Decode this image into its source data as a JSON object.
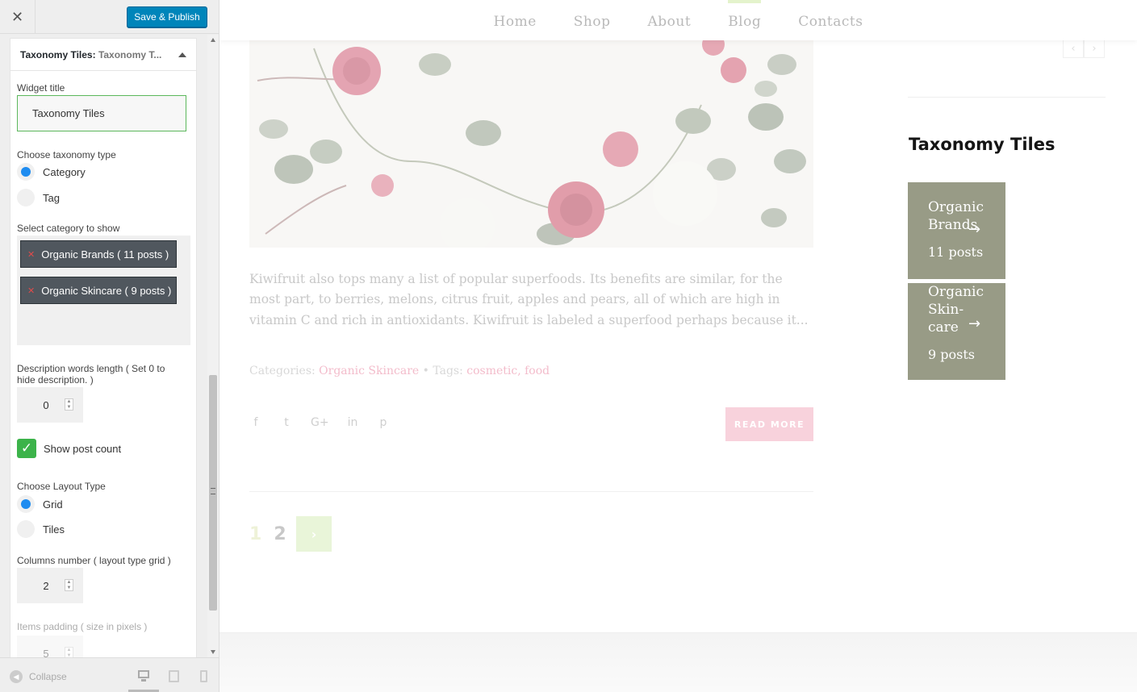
{
  "customizer": {
    "close_label": "✕",
    "publish_label": "Save & Publish",
    "widget": {
      "title": "Taxonomy Tiles:",
      "instance": "Taxonomy T...",
      "title_field_label": "Widget title",
      "title_field_value": "Taxonomy Tiles",
      "taxonomy_label": "Choose taxonomy type",
      "taxonomy_options": [
        "Category",
        "Tag"
      ],
      "taxonomy_selected": "Category",
      "category_label": "Select category to show",
      "selected_categories": [
        "Organic Brands ( 11 posts )",
        "Organic Skincare ( 9 posts )"
      ],
      "desc_length_label": "Description words length ( Set 0 to hide description. )",
      "desc_length_value": "0",
      "show_post_count_label": "Show post count",
      "show_post_count": true,
      "layout_label": "Choose Layout Type",
      "layout_options": [
        "Grid",
        "Tiles"
      ],
      "layout_selected": "Grid",
      "columns_label": "Columns number ( layout type grid )",
      "columns_value": "2",
      "padding_label": "Items padding ( size in pixels )",
      "padding_value": "5"
    },
    "footer": {
      "collapse_label": "Collapse",
      "devices": [
        "desktop-icon",
        "tablet-icon",
        "mobile-icon"
      ],
      "active_device": "desktop"
    }
  },
  "preview": {
    "nav": [
      "Home",
      "Shop",
      "About",
      "Blog",
      "Contacts"
    ],
    "nav_active": "Blog",
    "post": {
      "excerpt": "Kiwifruit also tops many a list of popular superfoods. Its benefits are similar, for the most part, to berries, melons, citrus fruit, apples and pears, all of which are high in vitamin C and rich in antioxidants. Kiwifruit is labeled a superfood perhaps because it...",
      "categories_label": "Categories:",
      "category": "Organic Skincare",
      "separator": "•",
      "tags_label": "Tags:",
      "tags": "cosmetic, food",
      "social": [
        "f",
        "t",
        "G+",
        "in",
        "p"
      ],
      "read_more": "READ MORE"
    },
    "pagination": {
      "pages": [
        "1",
        "2"
      ],
      "next": "›"
    },
    "slider_arrows": {
      "prev": "‹",
      "next": "›"
    },
    "sidebar": {
      "widget_title": "Taxonomy Tiles",
      "tiles": [
        {
          "name": "Organic Brands",
          "count": "11 posts"
        },
        {
          "name": "Organic Skin-care",
          "count": "9 posts"
        }
      ],
      "tile_arrow": "→"
    },
    "colors": {
      "tile_bg": "#989b86",
      "read_more_bg": "#f8d2dc",
      "link_pink": "#f3bccb",
      "publish_blue": "#0085ba",
      "check_green": "#3cb34a"
    }
  }
}
